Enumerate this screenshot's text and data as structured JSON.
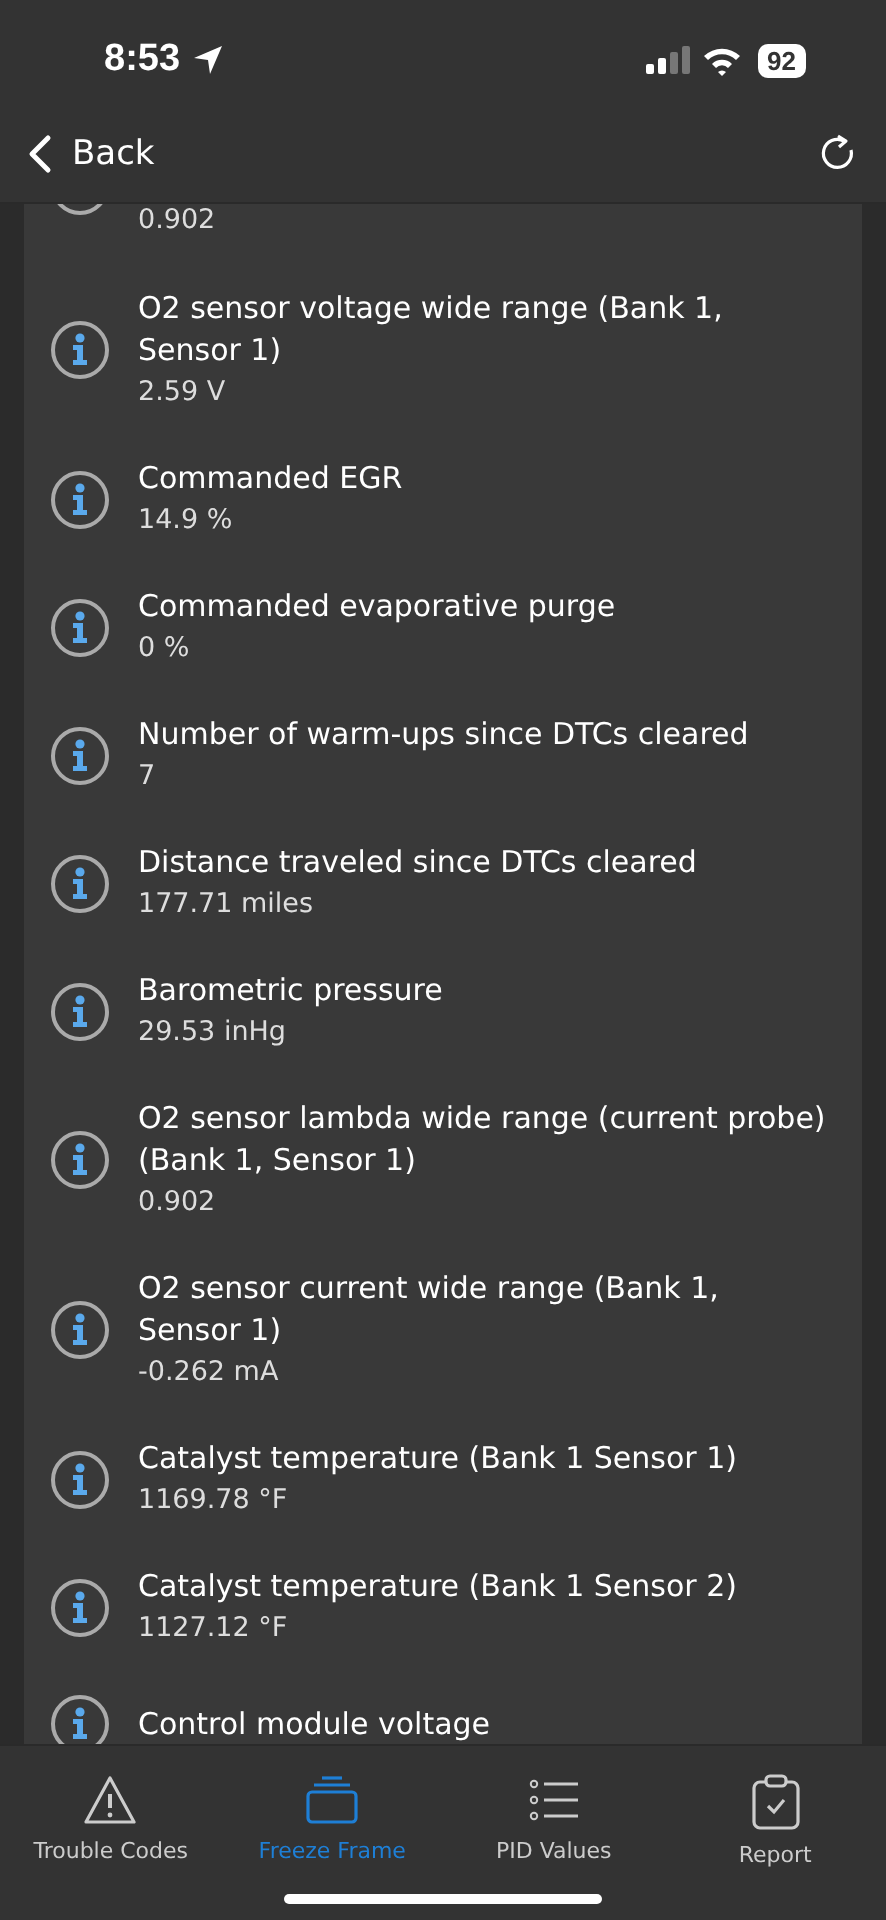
{
  "status_bar": {
    "time": "8:53",
    "battery": "92"
  },
  "nav": {
    "back": "Back"
  },
  "items": [
    {
      "value": "0.902"
    },
    {
      "title": "O2 sensor voltage wide range (Bank 1, Sensor 1)",
      "value": "2.59 V"
    },
    {
      "title": "Commanded EGR",
      "value": "14.9 %"
    },
    {
      "title": "Commanded evaporative purge",
      "value": "0 %"
    },
    {
      "title": "Number of warm-ups since DTCs cleared",
      "value": "7"
    },
    {
      "title": "Distance traveled since DTCs cleared",
      "value": "177.71 miles"
    },
    {
      "title": "Barometric pressure",
      "value": "29.53 inHg"
    },
    {
      "title": "O2 sensor lambda wide range (current probe) (Bank 1, Sensor 1)",
      "value": "0.902"
    },
    {
      "title": "O2 sensor current wide range (Bank 1, Sensor 1)",
      "value": "-0.262 mA"
    },
    {
      "title": "Catalyst temperature (Bank 1 Sensor 1)",
      "value": "1169.78 °F"
    },
    {
      "title": "Catalyst temperature (Bank 1 Sensor 2)",
      "value": "1127.12 °F"
    },
    {
      "title": "Control module voltage"
    }
  ],
  "tabs": [
    {
      "kind": "warning",
      "label": "Trouble Codes",
      "selected": false
    },
    {
      "kind": "frame",
      "label": "Freeze Frame",
      "selected": true
    },
    {
      "kind": "list",
      "label": "PID Values",
      "selected": false
    },
    {
      "kind": "report",
      "label": "Report",
      "selected": false
    }
  ]
}
